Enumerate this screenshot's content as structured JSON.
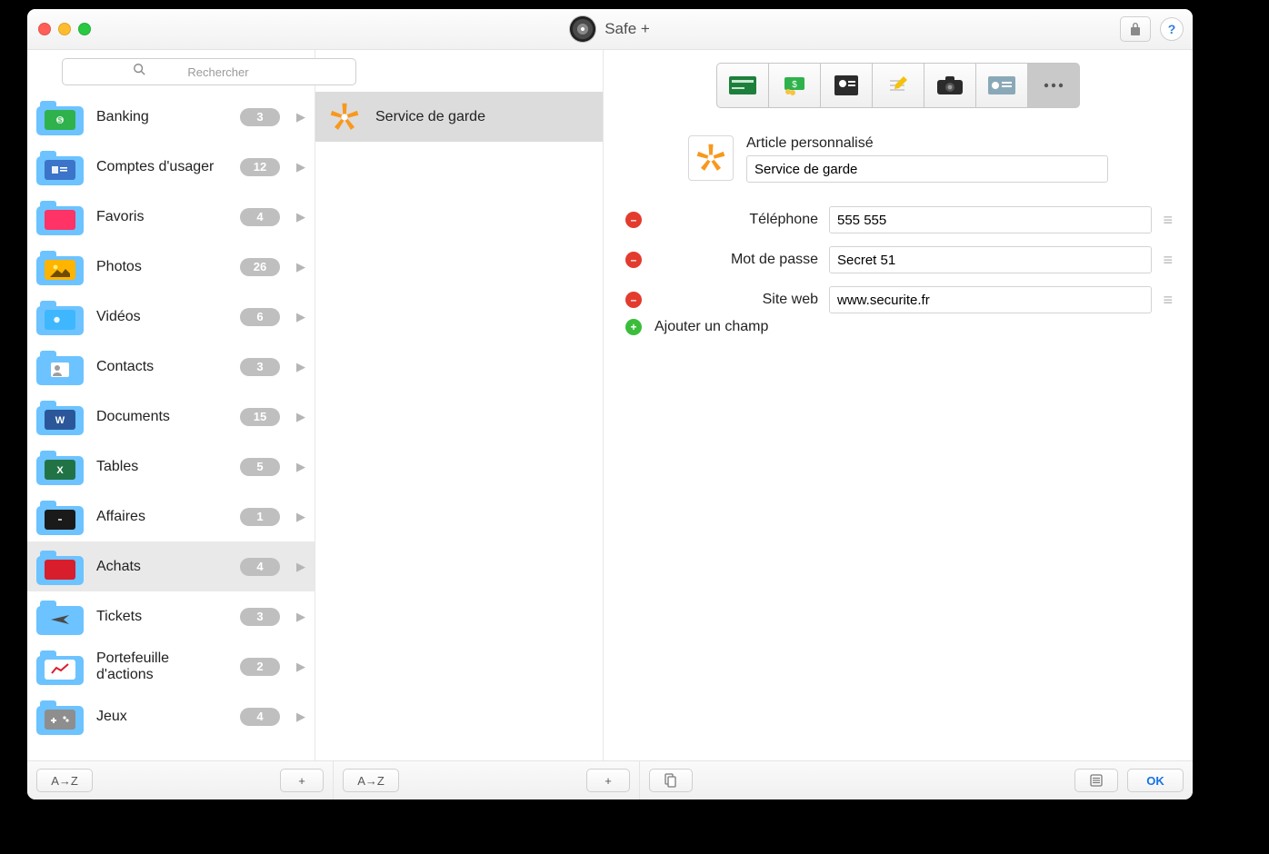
{
  "app": {
    "title": "Safe +",
    "search_placeholder": "Rechercher"
  },
  "sidebar": {
    "selected_index": 9,
    "categories": [
      {
        "id": "banking",
        "label": "Banking",
        "count": 3,
        "icon": "banknote",
        "icon_bg": "#2fb24c"
      },
      {
        "id": "accounts",
        "label": "Comptes d'usager",
        "count": 12,
        "icon": "id-card",
        "icon_bg": "#3b74c9"
      },
      {
        "id": "favorites",
        "label": "Favoris",
        "count": 4,
        "icon": "heart",
        "icon_bg": "#ff3366"
      },
      {
        "id": "photos",
        "label": "Photos",
        "count": 26,
        "icon": "photo",
        "icon_bg": "#ffb400"
      },
      {
        "id": "videos",
        "label": "Vidéos",
        "count": 6,
        "icon": "video",
        "icon_bg": "#3fb7ff"
      },
      {
        "id": "contacts",
        "label": "Contacts",
        "count": 3,
        "icon": "contact",
        "icon_bg": "#6cc3ff"
      },
      {
        "id": "documents",
        "label": "Documents",
        "count": 15,
        "icon": "word",
        "icon_bg": "#2b579a"
      },
      {
        "id": "tables",
        "label": "Tables",
        "count": 5,
        "icon": "excel",
        "icon_bg": "#217346"
      },
      {
        "id": "business",
        "label": "Affaires",
        "count": 1,
        "icon": "briefcase",
        "icon_bg": "#1a1a1a"
      },
      {
        "id": "shopping",
        "label": "Achats",
        "count": 4,
        "icon": "bag",
        "icon_bg": "#d81e2c"
      },
      {
        "id": "tickets",
        "label": "Tickets",
        "count": 3,
        "icon": "plane",
        "icon_bg": "#6cc3ff"
      },
      {
        "id": "portfolio",
        "label": "Portefeuille d'actions",
        "count": 2,
        "icon": "chart",
        "icon_bg": "#ffffff"
      },
      {
        "id": "games",
        "label": "Jeux",
        "count": 4,
        "icon": "gamepad",
        "icon_bg": "#8e8e8e"
      }
    ]
  },
  "items": {
    "selected_index": 0,
    "list": [
      {
        "id": "garde",
        "label": "Service de garde",
        "icon": "asterisk"
      }
    ]
  },
  "detail": {
    "type_label": "Article personnalisé",
    "title": "Service de garde",
    "add_field_label": "Ajouter un champ",
    "type_tabs": [
      {
        "id": "card",
        "icon": "credit-card"
      },
      {
        "id": "bank",
        "icon": "banknotes"
      },
      {
        "id": "contact",
        "icon": "person-card"
      },
      {
        "id": "note",
        "icon": "note"
      },
      {
        "id": "camera",
        "icon": "camera"
      },
      {
        "id": "license",
        "icon": "id"
      },
      {
        "id": "custom",
        "icon": "more",
        "selected": true
      }
    ],
    "fields": [
      {
        "label": "Téléphone",
        "value": "555 555"
      },
      {
        "label": "Mot de passe",
        "value": "Secret 51"
      },
      {
        "label": "Site web",
        "value": "www.securite.fr"
      }
    ]
  },
  "toolbar": {
    "sort_label": "A→Z",
    "ok_label": "OK"
  }
}
